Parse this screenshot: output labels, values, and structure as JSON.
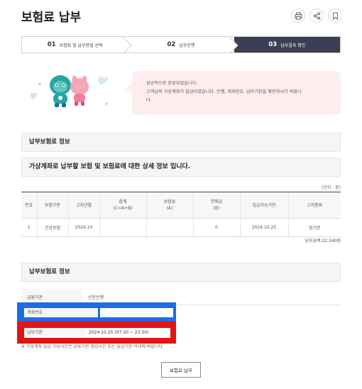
{
  "page": {
    "title": "보험료 납부"
  },
  "top_icons": [
    {
      "name": "print-icon"
    },
    {
      "name": "share-icon"
    },
    {
      "name": "bookmark-icon"
    }
  ],
  "steps": [
    {
      "num": "01",
      "label": "보험료 및 납부방법 선택"
    },
    {
      "num": "02",
      "label": "납부진행"
    },
    {
      "num": "03",
      "label": "납부결과 확인"
    }
  ],
  "banner": {
    "line1": "성공적으로 완료되었습니다.",
    "line2": "고객님의 가상계좌가 발급되었습니다. 은행, 계좌번호, 납부기한을 확인하시기 바랍니",
    "line3": "다."
  },
  "section1": {
    "title": "납부보험료 정보",
    "subtitle": "가상계좌로 납부할 보험 및 보험료에 대한 상세 정보 입니다."
  },
  "unit": "(단위 : 원)",
  "table": {
    "headers": [
      "번호",
      "보험구분",
      "고지년월",
      "합계\n(C=A+B)",
      "보험료\n(A)",
      "연체금\n(B)",
      "입금가능기한",
      "고지종류"
    ],
    "rows": [
      [
        "1",
        "건강보험",
        "2024.10",
        "",
        "",
        "0",
        "2024.10.25",
        "정기분"
      ]
    ]
  },
  "total": "납부금액:22,340원",
  "section2": {
    "title": "납부보험료 정보"
  },
  "info": {
    "bank_label": "금융기관",
    "bank_value": "신한은행",
    "account_label": "계좌번호",
    "deadline_label": "납부기한",
    "deadline_value": "2024.10.25  (07:30 ~ 23:30)"
  },
  "note": "※ 가상계좌 입금 가능시간은 금융기관 영업시간 또는 입금기한 이내에 바랍니다.",
  "pay_button": "보험료 납부",
  "colors": {
    "active_step": "#3c3f54",
    "banner_bg": "#fdeeed",
    "overlay_blue": "#1e6ce6",
    "overlay_red": "#e31414"
  }
}
